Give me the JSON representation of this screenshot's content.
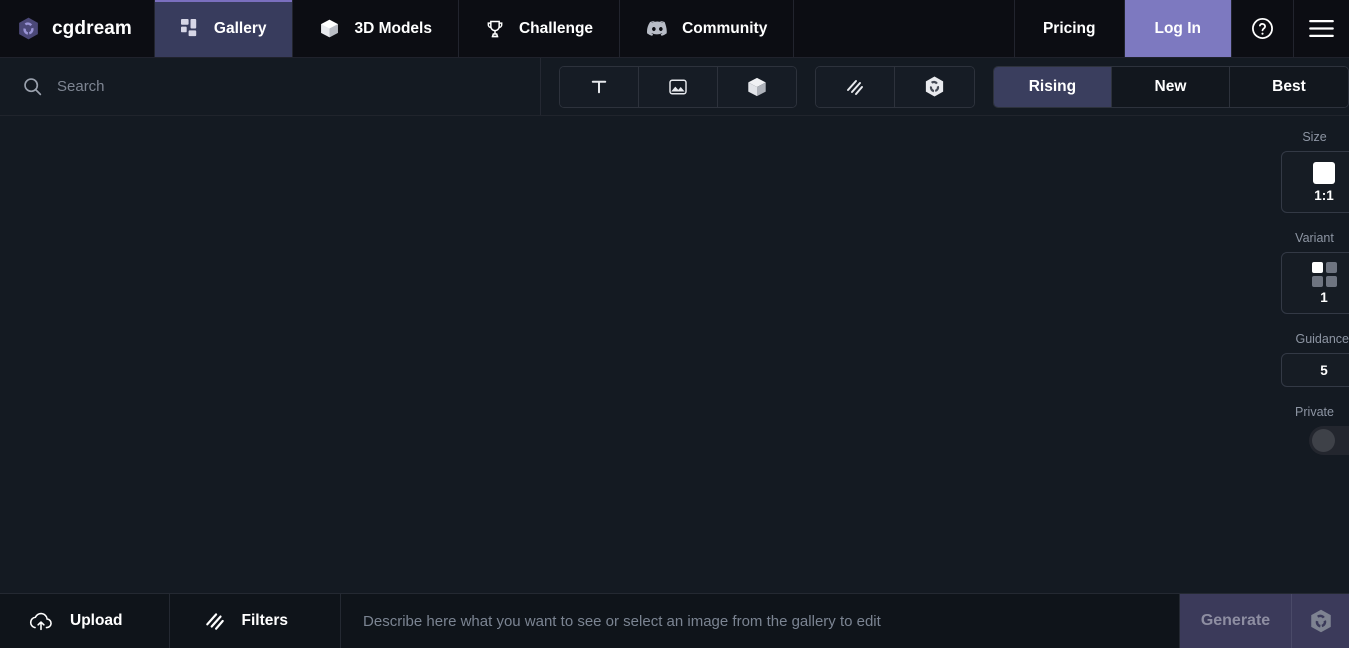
{
  "brand": {
    "name": "cgdream",
    "logo_icon": "cgdream-hex-logo-icon"
  },
  "topnav": {
    "tabs": [
      {
        "label": "Gallery",
        "icon": "grid-blocks-icon",
        "active": true
      },
      {
        "label": "3D Models",
        "icon": "cube-icon",
        "active": false
      },
      {
        "label": "Challenge",
        "icon": "trophy-icon",
        "active": false
      },
      {
        "label": "Community",
        "icon": "discord-icon",
        "active": false
      }
    ],
    "pricing_label": "Pricing",
    "login_label": "Log In",
    "help_icon": "question-circle-icon",
    "menu_icon": "hamburger-menu-icon",
    "active_tab_color": "#383c5d",
    "login_color": "#7d79c0"
  },
  "search": {
    "placeholder": "Search",
    "value": "",
    "icon": "search-icon"
  },
  "type_filters": [
    {
      "name": "text-filter",
      "icon": "text-t-icon"
    },
    {
      "name": "image-filter",
      "icon": "picture-icon"
    },
    {
      "name": "model-filter",
      "icon": "cube-icon"
    }
  ],
  "style_filters": [
    {
      "name": "sketch-filter",
      "icon": "diagonal-hatch-icon"
    },
    {
      "name": "cgdream-filter",
      "icon": "cgdream-hex-logo-icon"
    }
  ],
  "sort": {
    "options": [
      {
        "label": "Rising",
        "active": true
      },
      {
        "label": "New",
        "active": false
      },
      {
        "label": "Best",
        "active": false
      }
    ],
    "active_color": "#3a3e5e"
  },
  "side_panel": {
    "size": {
      "label": "Size",
      "value": "1:1",
      "icon": "square-ratio-icon"
    },
    "variant": {
      "label": "Variant",
      "value": "1",
      "icon": "grid-four-icon"
    },
    "guidance": {
      "label": "Guidance",
      "value": "5"
    },
    "private": {
      "label": "Private",
      "enabled": false
    }
  },
  "bottom_bar": {
    "upload_label": "Upload",
    "upload_icon": "cloud-upload-icon",
    "filters_label": "Filters",
    "filters_icon": "diagonal-hatch-icon",
    "prompt_placeholder": "Describe here what you want to see or select an image from the gallery to edit",
    "prompt_value": "",
    "generate_label": "Generate",
    "generate_icon": "cgdream-hex-logo-icon",
    "generate_color": "#3b3a5a"
  }
}
